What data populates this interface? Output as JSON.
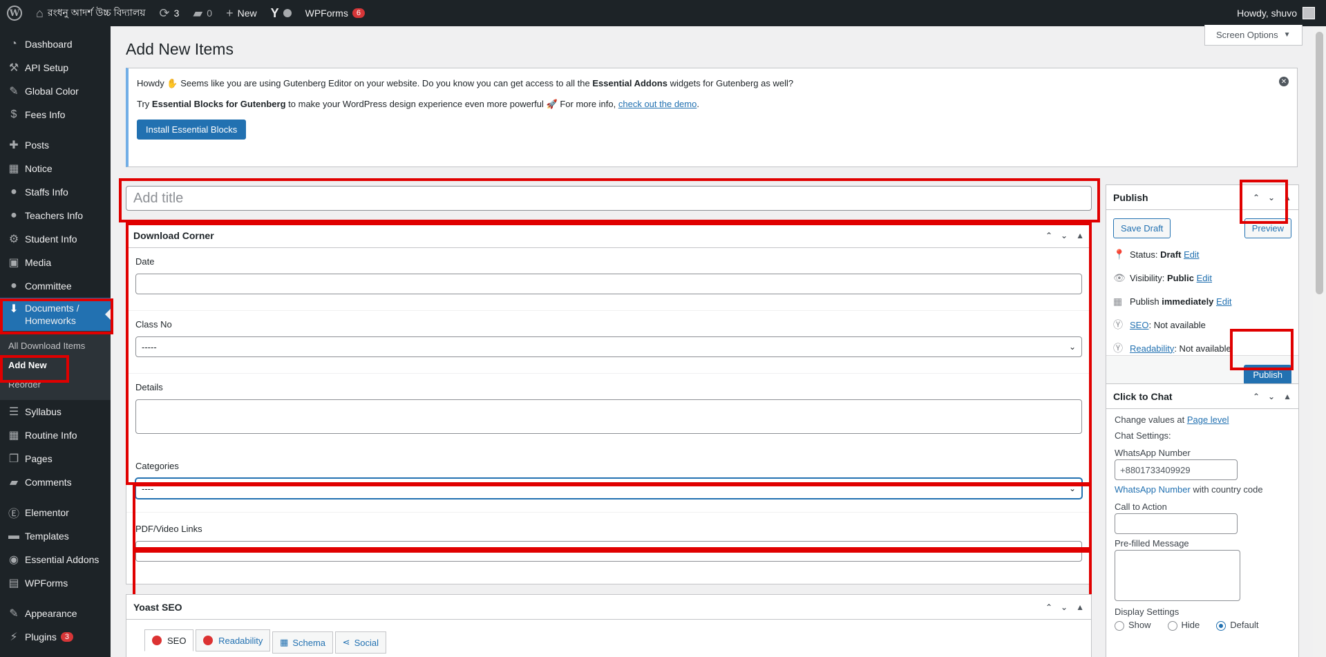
{
  "adminbar": {
    "site_name": "রংধনু আদর্শ উচ্চ বিদ্যালয়",
    "updates_count": "3",
    "comments_count": "0",
    "new_label": "New",
    "wpforms_label": "WPForms",
    "wpforms_badge": "6",
    "howdy": "Howdy, shuvo"
  },
  "sidebar": {
    "items": [
      {
        "label": "Dashboard",
        "icon": "dashboard-icon"
      },
      {
        "label": "API Setup",
        "icon": "tools-icon"
      },
      {
        "label": "Global Color",
        "icon": "brush-icon"
      },
      {
        "label": "Fees Info",
        "icon": "dollar-icon"
      },
      {
        "label": "Posts",
        "icon": "pin-icon"
      },
      {
        "label": "Notice",
        "icon": "calendar-icon"
      },
      {
        "label": "Staffs Info",
        "icon": "user-icon"
      },
      {
        "label": "Teachers Info",
        "icon": "user-icon"
      },
      {
        "label": "Student Info",
        "icon": "gear-icon"
      },
      {
        "label": "Media",
        "icon": "media-icon"
      },
      {
        "label": "Committee",
        "icon": "user-icon"
      },
      {
        "label": "Documents / Homeworks",
        "label1": "Documents /",
        "label2": "Homeworks",
        "icon": "download-icon"
      },
      {
        "label": "Syllabus",
        "icon": "list-icon"
      },
      {
        "label": "Routine Info",
        "icon": "calendar-icon"
      },
      {
        "label": "Pages",
        "icon": "pages-icon"
      },
      {
        "label": "Comments",
        "icon": "comment-icon"
      },
      {
        "label": "Elementor",
        "icon": "elementor-icon"
      },
      {
        "label": "Templates",
        "icon": "folder-icon"
      },
      {
        "label": "Essential Addons",
        "icon": "ea-icon"
      },
      {
        "label": "WPForms",
        "icon": "form-icon"
      },
      {
        "label": "Appearance",
        "icon": "brush-icon"
      },
      {
        "label": "Plugins",
        "icon": "plugin-icon",
        "badge": "3"
      }
    ],
    "submenu": [
      "All Download Items",
      "Add New",
      "Reorder"
    ]
  },
  "main": {
    "page_title": "Add New Items",
    "screen_options": "Screen Options",
    "notice": {
      "line1_pre": "Howdy",
      "line1_post": "Seems like you are using Gutenberg Editor on your website. Do you know you can get access to all the",
      "line1_bold": "Essential Addons",
      "line1_end": "widgets for Gutenberg as well?",
      "line2_pre": "Try",
      "line2_bold": "Essential Blocks for Gutenberg",
      "line2_mid": "to make your WordPress design experience even more powerful",
      "line2_post": "For more info,",
      "line2_link": "check out the demo",
      "button": "Install Essential Blocks"
    },
    "title_placeholder": "Add title",
    "download_corner": {
      "title": "Download Corner",
      "date_label": "Date",
      "class_label": "Class No",
      "class_value": "-----",
      "details_label": "Details",
      "categories_label": "Categories",
      "categories_value": "----",
      "links_label": "PDF/Video Links"
    },
    "yoast": {
      "title": "Yoast SEO",
      "tabs": [
        "SEO",
        "Readability",
        "Schema",
        "Social"
      ]
    }
  },
  "publish": {
    "title": "Publish",
    "save_draft": "Save Draft",
    "preview": "Preview",
    "status_label": "Status:",
    "status_value": "Draft",
    "visibility_label": "Visibility:",
    "visibility_value": "Public",
    "publish_label": "Publish",
    "publish_value": "immediately",
    "edit": "Edit",
    "seo_link": "SEO",
    "seo_value": ": Not available",
    "readability_link": "Readability",
    "readability_value": ": Not available",
    "publish_button": "Publish"
  },
  "chat": {
    "title": "Click to Chat",
    "change_values": "Change values at",
    "page_level": "Page level",
    "chat_settings": "Chat Settings:",
    "wa_label": "WhatsApp Number",
    "wa_value": "+8801733409929",
    "wa_hint_link": "WhatsApp Number",
    "wa_hint": "with country code",
    "cta_label": "Call to Action",
    "prefilled_label": "Pre-filled Message",
    "display_label": "Display Settings",
    "options": [
      "Show",
      "Hide",
      "Default"
    ]
  },
  "colors": {
    "accent": "#2271b1",
    "highlight_red": "#e00000",
    "sidebar_bg": "#1d2327"
  }
}
